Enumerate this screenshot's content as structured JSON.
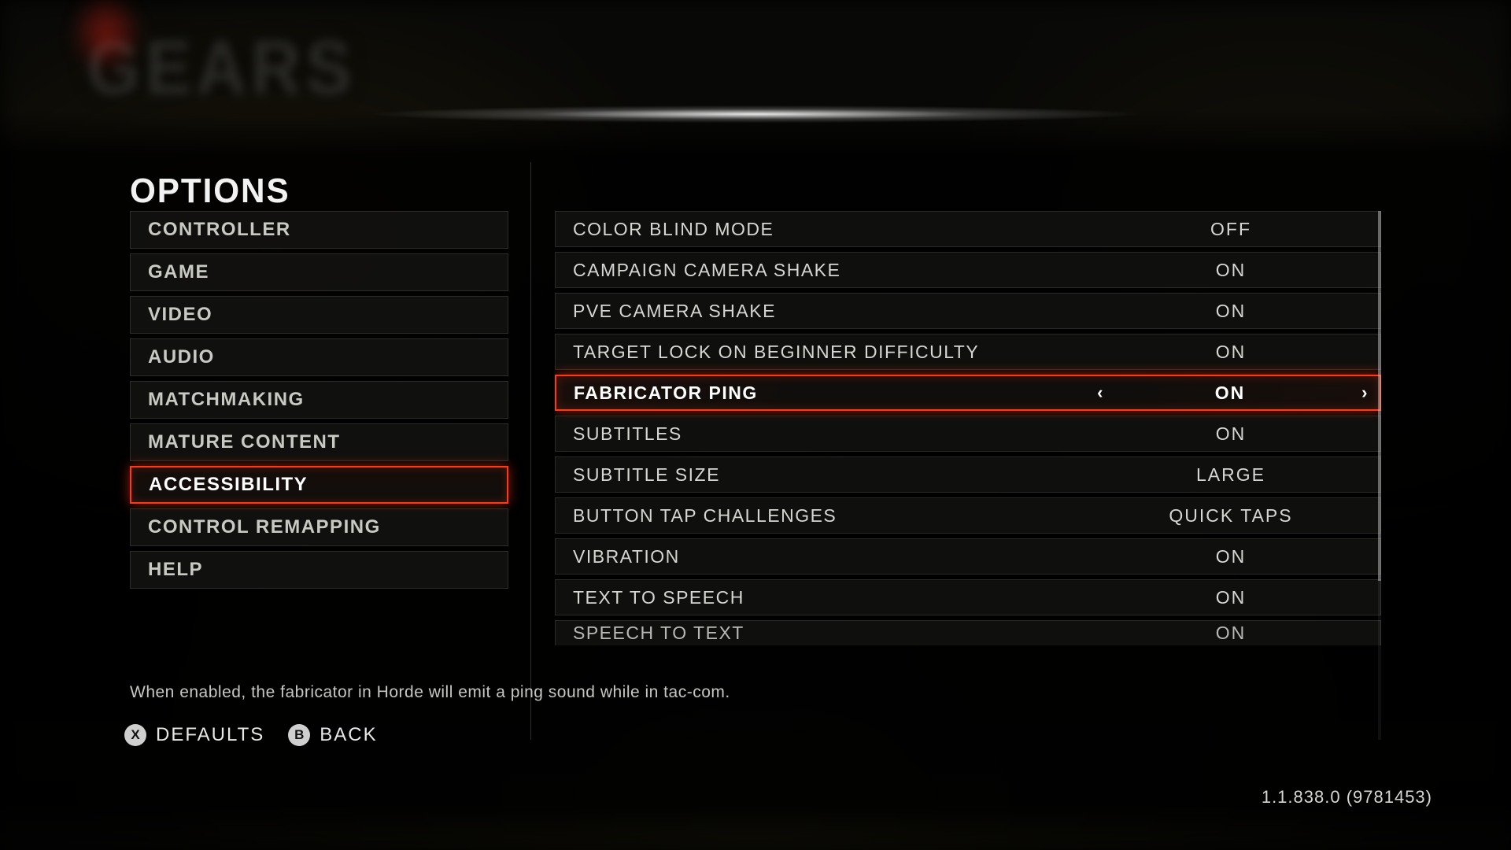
{
  "page_title": "OPTIONS",
  "bg_logomark": "GEARS",
  "categories": [
    {
      "label": "CONTROLLER",
      "selected": false
    },
    {
      "label": "GAME",
      "selected": false
    },
    {
      "label": "VIDEO",
      "selected": false
    },
    {
      "label": "AUDIO",
      "selected": false
    },
    {
      "label": "MATCHMAKING",
      "selected": false
    },
    {
      "label": "MATURE CONTENT",
      "selected": false
    },
    {
      "label": "ACCESSIBILITY",
      "selected": true
    },
    {
      "label": "CONTROL REMAPPING",
      "selected": false
    },
    {
      "label": "HELP",
      "selected": false
    }
  ],
  "settings": [
    {
      "label": "COLOR BLIND MODE",
      "value": "OFF",
      "selected": false
    },
    {
      "label": "CAMPAIGN CAMERA SHAKE",
      "value": "ON",
      "selected": false
    },
    {
      "label": "PVE CAMERA SHAKE",
      "value": "ON",
      "selected": false
    },
    {
      "label": "TARGET LOCK ON BEGINNER DIFFICULTY",
      "value": "ON",
      "selected": false
    },
    {
      "label": "FABRICATOR PING",
      "value": "ON",
      "selected": true
    },
    {
      "label": "SUBTITLES",
      "value": "ON",
      "selected": false
    },
    {
      "label": "SUBTITLE SIZE",
      "value": "LARGE",
      "selected": false
    },
    {
      "label": "BUTTON TAP CHALLENGES",
      "value": "QUICK TAPS",
      "selected": false
    },
    {
      "label": "VIBRATION",
      "value": "ON",
      "selected": false
    },
    {
      "label": "TEXT TO SPEECH",
      "value": "ON",
      "selected": false
    },
    {
      "label": "SPEECH TO TEXT",
      "value": "ON",
      "selected": false
    }
  ],
  "hint_text": "When enabled, the fabricator in Horde will emit a ping sound while in tac-com.",
  "footer": {
    "defaults": {
      "glyph": "X",
      "label": "DEFAULTS"
    },
    "back": {
      "glyph": "B",
      "label": "BACK"
    }
  },
  "version": "1.1.838.0 (9781453)"
}
